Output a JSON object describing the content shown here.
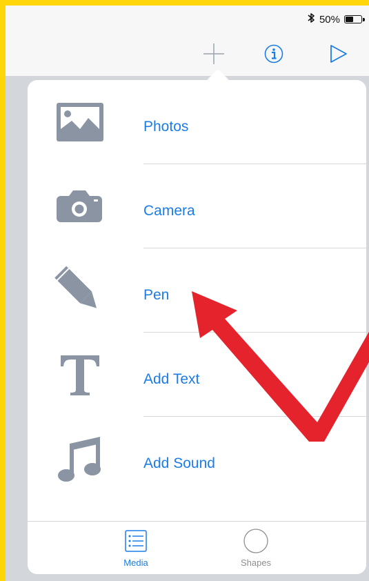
{
  "status_bar": {
    "bluetooth_icon": "bluetooth-icon",
    "battery_text": "50%",
    "battery_level": 0.5
  },
  "toolbar": {
    "add_icon": "plus-icon",
    "info_icon": "info-icon",
    "play_icon": "play-icon"
  },
  "popover": {
    "menu": [
      {
        "label": "Photos",
        "icon": "photo-icon"
      },
      {
        "label": "Camera",
        "icon": "camera-icon"
      },
      {
        "label": "Pen",
        "icon": "pencil-icon"
      },
      {
        "label": "Add Text",
        "icon": "text-icon"
      },
      {
        "label": "Add Sound",
        "icon": "music-note-icon"
      }
    ],
    "tabs": [
      {
        "label": "Media",
        "icon": "list-icon",
        "selected": true
      },
      {
        "label": "Shapes",
        "icon": "circle-icon",
        "selected": false
      }
    ]
  },
  "colors": {
    "frame": "#FFD60A",
    "accent": "#1C7CE5",
    "icon_gray": "#8A94A3",
    "annotation_arrow": "#E4232C"
  }
}
